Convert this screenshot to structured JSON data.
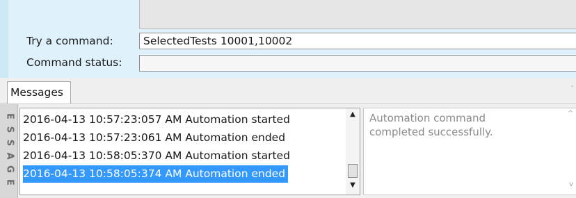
{
  "command_panel": {
    "try_label": "Try a command:",
    "command_value": "SelectedTests 10001,10002",
    "status_label": "Command status:",
    "status_value": ""
  },
  "tabs": [
    {
      "label": "Messages"
    }
  ],
  "side_tab": {
    "letters": [
      "E",
      "S",
      "S",
      "A",
      "G",
      "E"
    ]
  },
  "messages": {
    "rows": [
      {
        "text": "2016-04-13 10:57:23:057 AM Automation started",
        "selected": false
      },
      {
        "text": "2016-04-13 10:57:23:061 AM Automation ended",
        "selected": false
      },
      {
        "text": "2016-04-13 10:58:05:370 AM Automation started",
        "selected": false
      },
      {
        "text": "2016-04-13 10:58:05:374 AM Automation ended",
        "selected": true
      }
    ],
    "scroll_up_glyph": "▲",
    "scroll_down_glyph": "▼"
  },
  "detail": {
    "text": "Automation command completed successfully.",
    "scroll_up_glyph": "^",
    "scroll_down_glyph": "v"
  },
  "colors": {
    "selection": "#3399ff",
    "panel_bg": "#dff1fb"
  }
}
